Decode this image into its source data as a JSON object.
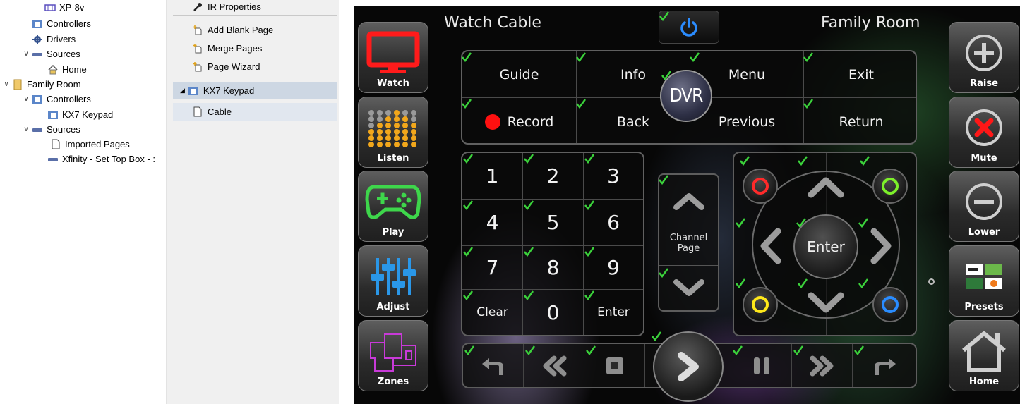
{
  "tree": {
    "items": [
      {
        "label": "XP-8v",
        "icon": "device-icon",
        "depth": 3,
        "expander": ""
      },
      {
        "label": "Controllers",
        "icon": "controller-folder-icon",
        "depth": 2,
        "expander": ""
      },
      {
        "label": "Drivers",
        "icon": "gear-icon",
        "depth": 2,
        "expander": ""
      },
      {
        "label": "Sources",
        "icon": "sources-icon",
        "depth": 2,
        "expander": "v"
      },
      {
        "label": "Home",
        "icon": "home-icon",
        "depth": 3,
        "expander": ""
      },
      {
        "label": "Family Room",
        "icon": "room-icon",
        "depth": 0,
        "expander": "v"
      },
      {
        "label": "Controllers",
        "icon": "controller-folder-icon",
        "depth": 1,
        "expander": "v"
      },
      {
        "label": "KX7 Keypad",
        "icon": "keypad-icon",
        "depth": 2,
        "expander": ""
      },
      {
        "label": "Sources",
        "icon": "sources-icon",
        "depth": 1,
        "expander": "v"
      },
      {
        "label": "Imported Pages",
        "icon": "page-icon",
        "depth": 2,
        "expander": ""
      },
      {
        "label": "Xfinity - Set Top Box - :",
        "icon": "settop-icon",
        "depth": 2,
        "expander": ""
      }
    ]
  },
  "pages_panel": {
    "ir_properties": "IR Properties",
    "add_blank_page": "Add Blank Page",
    "merge_pages": "Merge Pages",
    "page_wizard": "Page Wizard",
    "group_label": "KX7 Keypad",
    "page_label": "Cable"
  },
  "header": {
    "title": "Watch Cable",
    "room": "Family Room"
  },
  "left_buttons": [
    "Watch",
    "Listen",
    "Play",
    "Adjust",
    "Zones"
  ],
  "right_buttons": [
    "Raise",
    "Mute",
    "Lower",
    "Presets",
    "Home"
  ],
  "top_grid": {
    "row1": [
      "Guide",
      "Info",
      "Menu",
      "Exit"
    ],
    "row2": [
      "Record",
      "Back",
      "Previous",
      "Return"
    ],
    "center_badge": "DVR"
  },
  "keypad": {
    "keys": [
      "1",
      "2",
      "3",
      "4",
      "5",
      "6",
      "7",
      "8",
      "9",
      "Clear",
      "0",
      "Enter"
    ]
  },
  "channel_page": {
    "line1": "Channel",
    "line2": "Page"
  },
  "nav": {
    "enter_label": "Enter",
    "colors": {
      "red": "#ff2a2a",
      "green": "#7df02a",
      "yellow": "#ffe81a",
      "blue": "#2a8cff"
    }
  },
  "colors": {
    "accent_red": "#ff1010",
    "check_green": "#3bd23b",
    "power_blue": "#2b8cff"
  }
}
